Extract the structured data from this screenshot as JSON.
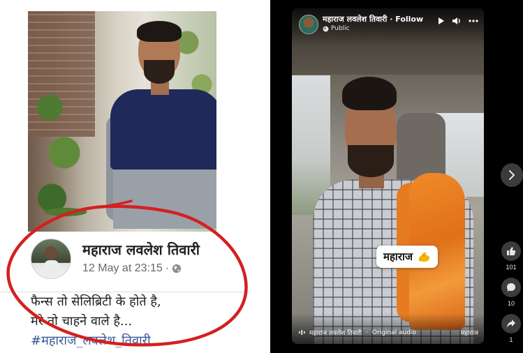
{
  "facebook_post": {
    "author": "महाराज लवलेश तिवारी",
    "date": "12 May at 23:15",
    "separator": "·",
    "line1": "फैन्स तो सेलिब्रिटी के होते है,",
    "line2": "मेरे तो चाहने वाले है...",
    "hashtag": "#महाराज_लवलेश_तिवारी"
  },
  "reel": {
    "author": "महाराज लवलेश तिवारी",
    "follow_label": "Follow",
    "follow_separator": "·",
    "privacy": "Public",
    "sticker_text": "महाराज",
    "audio_author": "महाराज लवलेश तिवारी",
    "audio_separator": "·",
    "audio_label": "Original audio",
    "audio_end": "महाराज"
  },
  "actions": {
    "likes": "101",
    "comments": "10",
    "shares": "1"
  },
  "icons": [
    "globe-icon",
    "play-icon",
    "volume-icon",
    "more-icon",
    "chevron-right-icon",
    "like-icon",
    "comment-icon",
    "share-icon",
    "flexed-biceps-icon",
    "audio-wave-icon"
  ],
  "colors": {
    "annotation_circle": "#d42020",
    "hashtag": "#385898",
    "reel_background": "#000000",
    "scarf": "#e0701a"
  }
}
